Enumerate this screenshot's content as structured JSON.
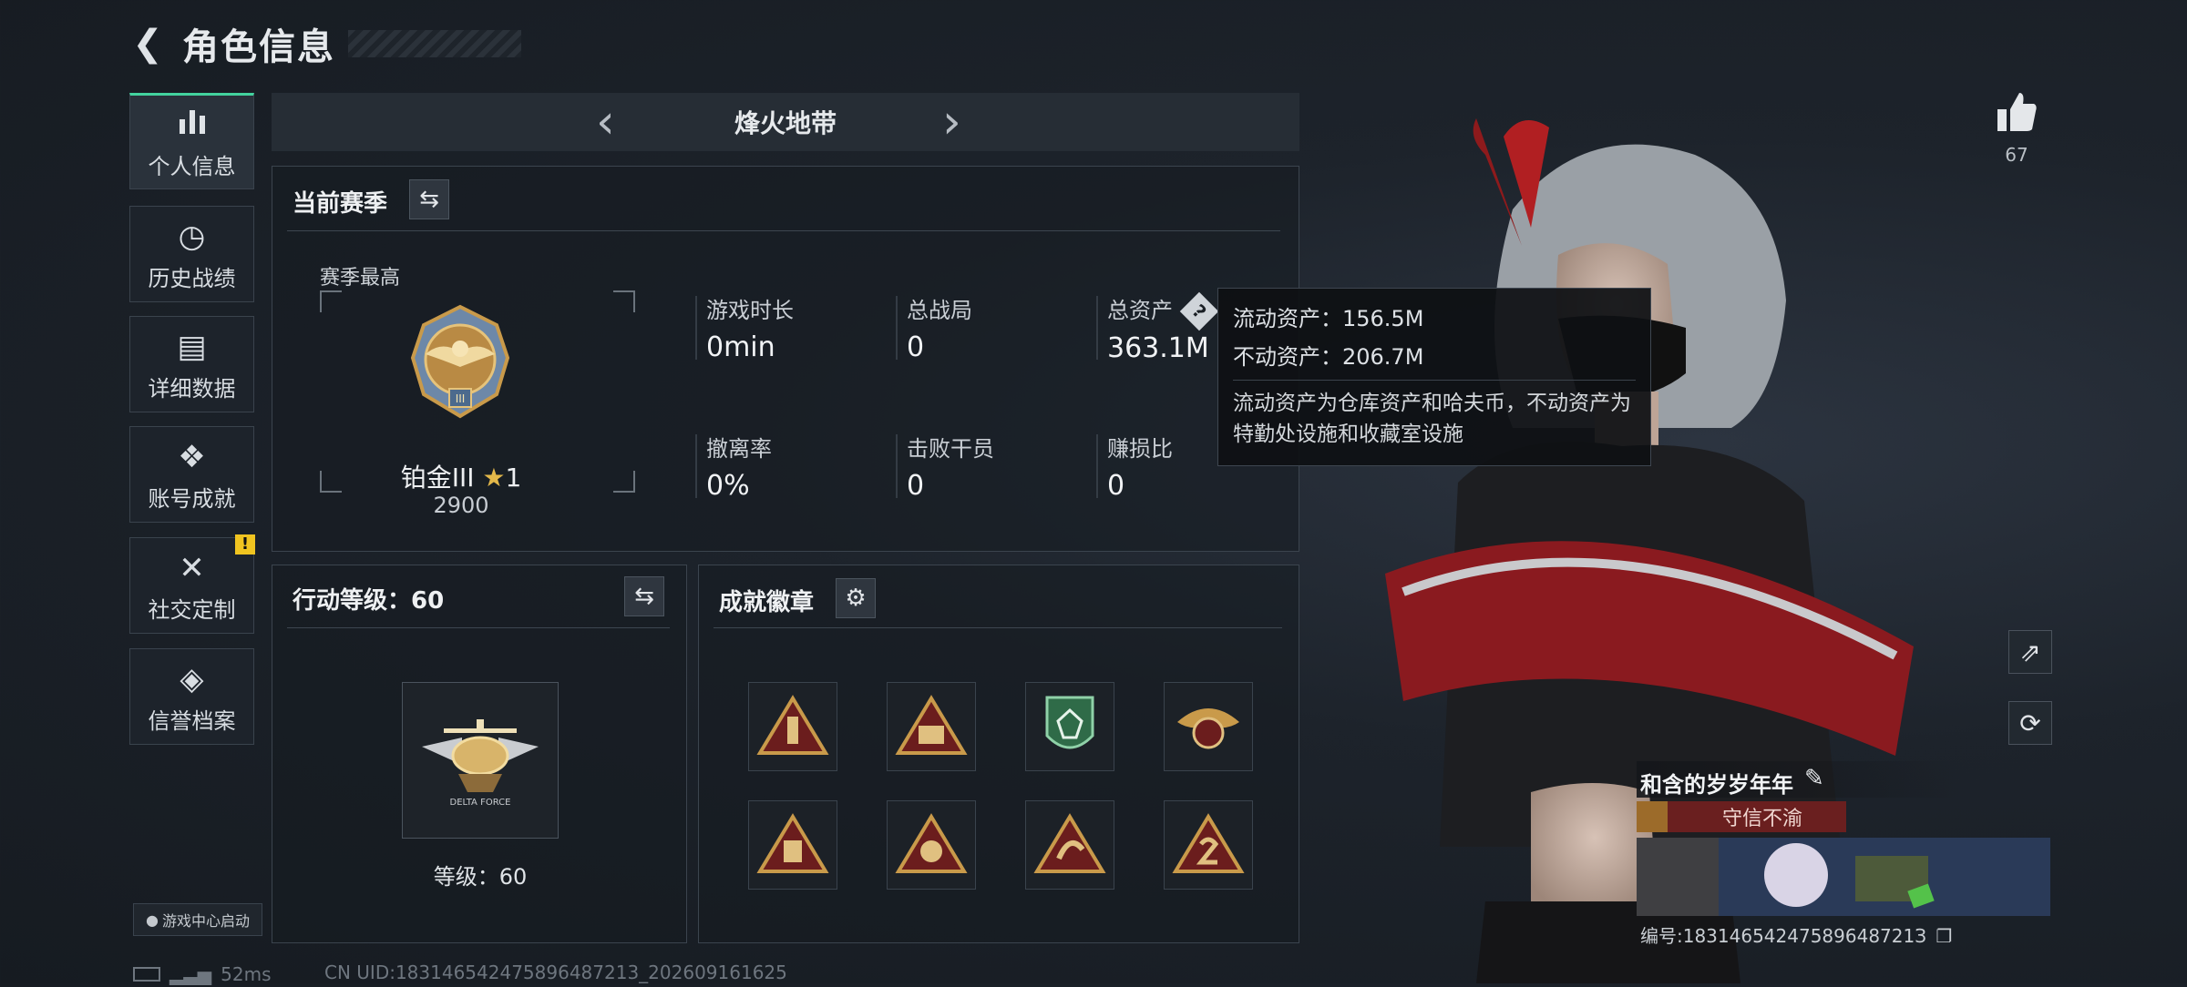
{
  "header": {
    "back_icon": "back-arrow-icon",
    "title": "角色信息"
  },
  "sidebar": {
    "items": [
      {
        "label": "个人信息",
        "icon": "bar-chart-icon",
        "glyph": "▐▌",
        "active": true
      },
      {
        "label": "历史战绩",
        "icon": "clock-icon",
        "glyph": "◷"
      },
      {
        "label": "详细数据",
        "icon": "folder-icon",
        "glyph": "▤"
      },
      {
        "label": "账号成就",
        "icon": "achievement-icon",
        "glyph": "❖"
      },
      {
        "label": "社交定制",
        "icon": "tools-icon",
        "glyph": "✕",
        "alert": "!"
      },
      {
        "label": "信誉档案",
        "icon": "shield-icon",
        "glyph": "◈"
      }
    ],
    "game_center": "游戏中心启动"
  },
  "season_nav": {
    "title": "烽火地带",
    "prev": "‹",
    "next": "›"
  },
  "current_season": {
    "title": "当前赛季",
    "swap_glyph": "⇆",
    "season_best": "赛季最高",
    "rank_name": "铂金III",
    "star_icon": "★",
    "stars": "1",
    "score": "2900",
    "stats": [
      {
        "label": "游戏时长",
        "value": "0min"
      },
      {
        "label": "总战局",
        "value": "0"
      },
      {
        "label": "总资产",
        "value": "363.1M",
        "help": "?"
      },
      {
        "label": "撤离率",
        "value": "0%"
      },
      {
        "label": "击败干员",
        "value": "0"
      },
      {
        "label": "赚损比",
        "value": "0"
      }
    ]
  },
  "tooltip": {
    "liquid": "流动资产：156.5M",
    "fixed": "不动资产：206.7M",
    "desc": "流动资产为仓库资产和哈夫币，不动资产为特勤处设施和收藏室设施"
  },
  "action_level": {
    "title": "行动等级：60",
    "swap_glyph": "⇆",
    "level_text": "等级：60"
  },
  "achievements": {
    "title": "成就徽章",
    "settings_glyph": "⚙",
    "badge_count": 8
  },
  "right": {
    "like_icon": "thumbs-up-icon",
    "likes": "67",
    "share_glyph": "⇗",
    "refresh_glyph": "⟳"
  },
  "profile": {
    "name": "和含的岁岁年年",
    "edit_glyph": "✎",
    "tag": "守信不渝",
    "id_text": "编号:18314654247589648721З",
    "copy_glyph": "❐"
  },
  "footer": {
    "ping": "52ms",
    "uid": "CN UID:183146542475896487213_202609161625"
  },
  "colors": {
    "accent": "#43d39e",
    "tag_bg": "#6a1f1f",
    "warn": "#f0c420",
    "gold": "#c99a4a"
  }
}
